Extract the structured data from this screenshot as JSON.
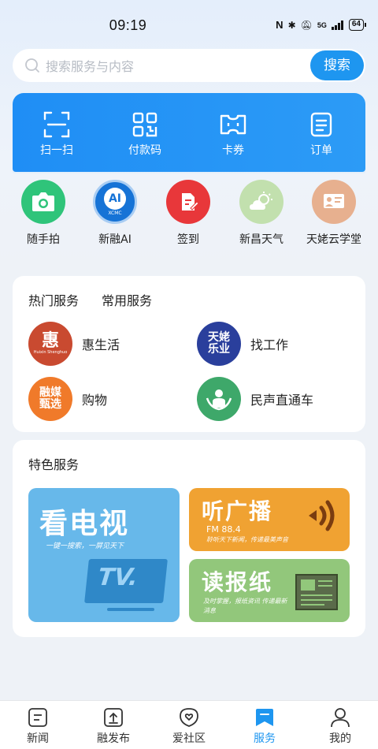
{
  "status_bar": {
    "time": "09:19",
    "network": "5G",
    "battery": "64"
  },
  "search": {
    "placeholder": "搜索服务与内容",
    "button": "搜索"
  },
  "quick_actions": [
    {
      "label": "扫一扫",
      "icon": "scan-icon"
    },
    {
      "label": "付款码",
      "icon": "payment-code-icon"
    },
    {
      "label": "卡券",
      "icon": "coupon-icon"
    },
    {
      "label": "订单",
      "icon": "order-icon"
    }
  ],
  "apps": [
    {
      "label": "随手拍",
      "icon": "camera-icon",
      "color": "#2fc47a"
    },
    {
      "label": "新融AI",
      "icon": "ai-logo-icon",
      "color": "#1673d6",
      "badge_text": "AI",
      "badge_sub": "XCMC"
    },
    {
      "label": "签到",
      "icon": "sign-in-icon",
      "color": "#e8373a"
    },
    {
      "label": "新昌天气",
      "icon": "weather-icon",
      "color": "#b9dca6"
    },
    {
      "label": "天姥云学堂",
      "icon": "classroom-icon",
      "color": "#e7b08f"
    }
  ],
  "services": {
    "tabs": [
      "热门服务",
      "常用服务"
    ],
    "items": [
      {
        "label": "惠生活",
        "logo_text": "惠",
        "logo_sub": "Huixin Shenghuo",
        "color": "#c94a30"
      },
      {
        "label": "找工作",
        "logo_text": "天姥乐业",
        "color": "#2a3f9c"
      },
      {
        "label": "购物",
        "logo_text": "融媒甄选",
        "color": "#f07a2a"
      },
      {
        "label": "民声直通车",
        "logo_text": "",
        "color": "#3ea86a"
      }
    ]
  },
  "featured": {
    "title": "特色服务",
    "tv": {
      "title": "看电视",
      "subtitle": "一键一搜索，一屏见天下",
      "screen_text": "TV.",
      "color": "#67b8ea"
    },
    "radio": {
      "title": "听广播",
      "freq": "FM 88.4",
      "subtitle": "聆听天下新闻，传递最美声音",
      "color": "#f0a232"
    },
    "paper": {
      "title": "读报纸",
      "subtitle": "及时掌握，报纸资讯 传递最新消息",
      "color": "#92c77b"
    }
  },
  "bottom_nav": [
    {
      "label": "新闻",
      "icon": "news-icon",
      "active": false
    },
    {
      "label": "融发布",
      "icon": "publish-icon",
      "active": false
    },
    {
      "label": "爱社区",
      "icon": "community-icon",
      "active": false
    },
    {
      "label": "服务",
      "icon": "service-icon",
      "active": true
    },
    {
      "label": "我的",
      "icon": "profile-icon",
      "active": false
    }
  ],
  "colors": {
    "accent": "#1e96f0",
    "background": "#eef2f7"
  }
}
